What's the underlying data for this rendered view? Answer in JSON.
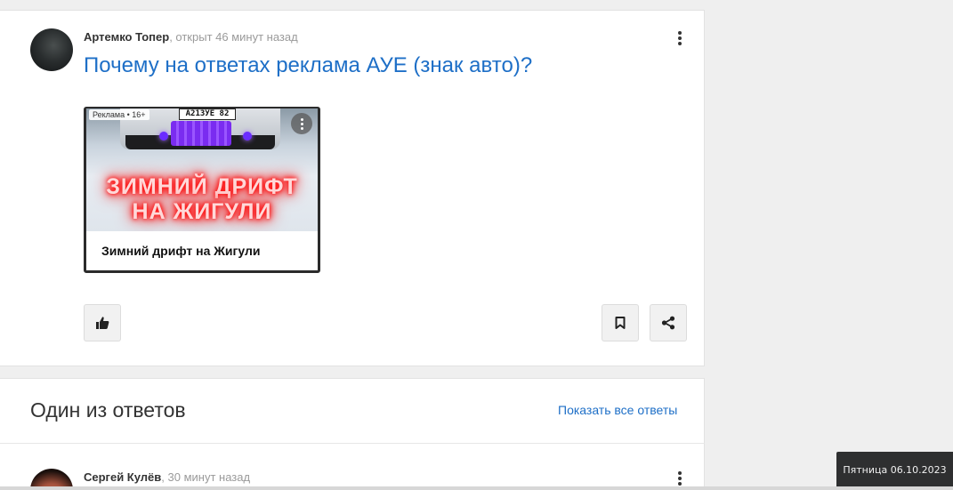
{
  "question": {
    "author": "Артемко Топер",
    "time": ", открыт 46 минут назад",
    "title": "Почему на ответах реклама АУЕ (знак авто)?",
    "ad": {
      "tag": "Реклама • 16+",
      "plate": "А213УЕ 82",
      "headline": "ЗИМНИЙ ДРИФТ НА ЖИГУЛИ",
      "caption": "Зимний дрифт на Жигули"
    },
    "icons": {
      "like": "thumbs-up-icon",
      "bookmark": "bookmark-icon",
      "share": "share-icon",
      "more": "more-vertical-icon"
    }
  },
  "answers": {
    "heading": "Один из ответов",
    "show_all": "Показать все ответы",
    "first": {
      "author": "Сергей Кулёв",
      "time": ", 30 минут назад"
    }
  },
  "taskbar": {
    "clock": "Пятница 06.10.2023"
  },
  "colors": {
    "link": "#1e6fc7",
    "background": "#efefef",
    "ad_glow": "#ff0000"
  }
}
